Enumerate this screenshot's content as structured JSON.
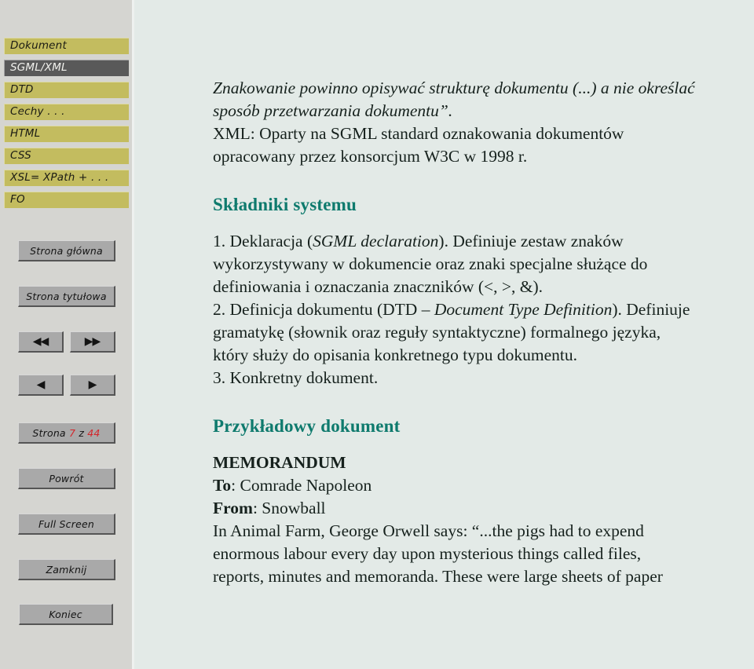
{
  "sidebar": {
    "nav_tabs": [
      {
        "label": "Dokument",
        "active": false
      },
      {
        "label": "SGML/XML",
        "active": true
      },
      {
        "label": "DTD",
        "active": false
      },
      {
        "label": "Cechy . . .",
        "active": false
      },
      {
        "label": "HTML",
        "active": false
      },
      {
        "label": "CSS",
        "active": false
      },
      {
        "label": "XSL= XPath + . . .",
        "active": false
      },
      {
        "label": "FO",
        "active": false
      }
    ],
    "home_button": "Strona główna",
    "title_page_button": "Strona tytułowa",
    "first_button": "◀◀",
    "last_button": "▶▶",
    "prev_button": "◀",
    "next_button": "▶",
    "page_counter": {
      "prefix": "Strona",
      "current": "7",
      "separator": "z",
      "total": "44"
    },
    "back_button": "Powrót",
    "fullscreen_button": "Full Screen",
    "close_button": "Zamknij",
    "end_button": "Koniec"
  },
  "main": {
    "quote_line1": "Znakowanie powinno opisywać strukturę dokumentu (...) a nie określać",
    "quote_line2": "sposób przetwarzania dokumentu”.",
    "xml_line1": "XML: Oparty na SGML standard oznakowania dokumentów",
    "xml_line2": "opracowany przez konsorcjum W3C w 1998 r.",
    "heading_components": "Składniki systemu",
    "item1_line1_a": "1. Deklaracja (",
    "item1_line1_i": "SGML declaration",
    "item1_line1_b": "). Definiuje zestaw znaków",
    "item1_line2": "wykorzystywany w dokumencie oraz znaki specjalne służące do",
    "item1_line3": "definiowania i oznaczania znaczników (<, >, &).",
    "item2_line1_a": "2. Definicja dokumentu (DTD – ",
    "item2_line1_i": "Document Type Definition",
    "item2_line1_b": "). Definiuje",
    "item2_line2": "gramatykę (słownik oraz reguły syntaktyczne) formalnego języka,",
    "item2_line3": "który służy do opisania konkretnego typu dokumentu.",
    "item3": "3. Konkretny dokument.",
    "heading_example": "Przykładowy dokument",
    "memo_title": "MEMORANDUM",
    "memo_to_label": "To",
    "memo_to_value": ": Comrade Napoleon",
    "memo_from_label": "From",
    "memo_from_value": ": Snowball",
    "body_line1": "In Animal Farm, George Orwell says: “...the pigs had to expend",
    "body_line2": "enormous labour every day upon mysterious things called files,",
    "body_line3": "reports, minutes and memoranda. These were large sheets of paper"
  }
}
